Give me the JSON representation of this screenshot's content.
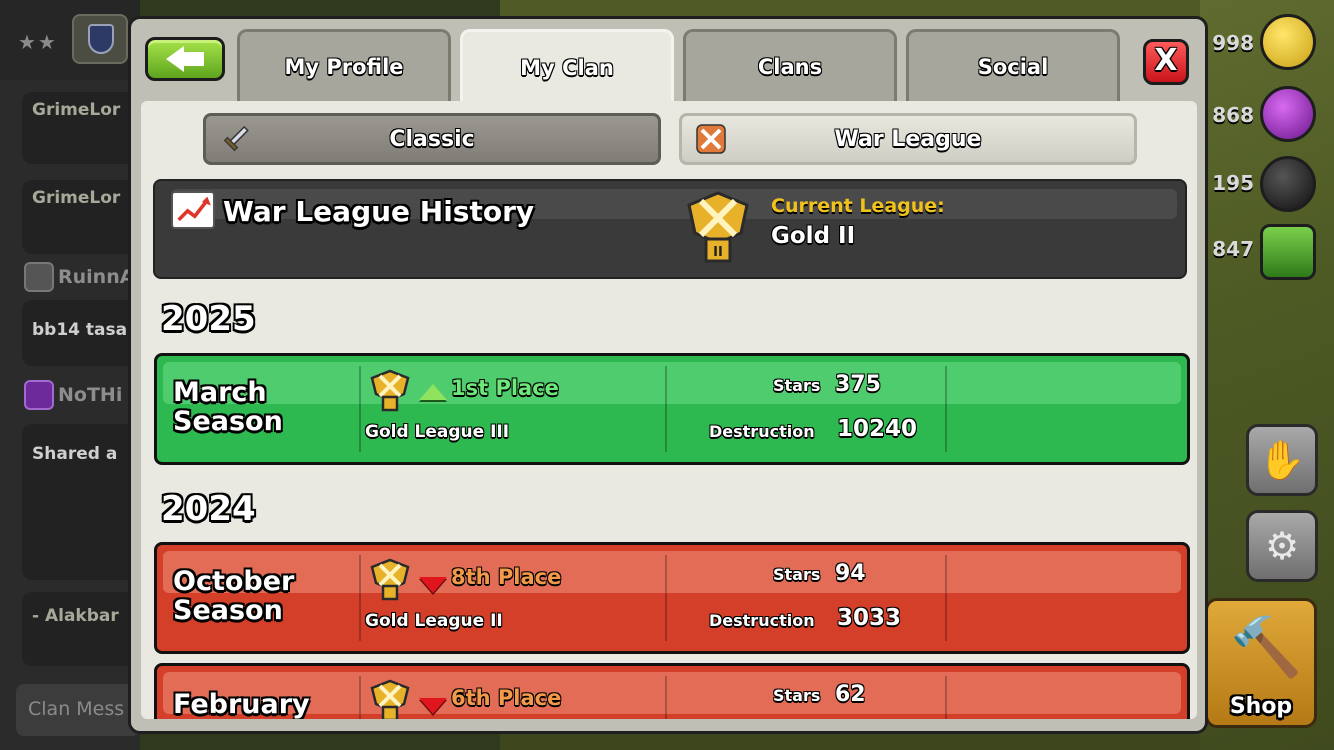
{
  "background": {
    "chat": {
      "messages": [
        {
          "user": "GrimeLor"
        },
        {
          "user": "GrimeLor"
        },
        {
          "user": "RuinnA",
          "text": "bb14 tasa"
        },
        {
          "user": "NoTHi",
          "text": "Shared a"
        },
        {
          "text": "- Alakbar"
        }
      ],
      "input_placeholder": "Clan Mess"
    },
    "resources": {
      "gold": "998",
      "elixir": "868",
      "dark_elixir": "195",
      "gems": "847"
    },
    "shop_label": "Shop"
  },
  "tabs": [
    {
      "label": "My Profile",
      "active": false
    },
    {
      "label": "My Clan",
      "active": true
    },
    {
      "label": "Clans",
      "active": false
    },
    {
      "label": "Social",
      "active": false
    }
  ],
  "close_label": "X",
  "sub_tabs": {
    "classic": "Classic",
    "war_league": "War League"
  },
  "history": {
    "title": "War League History",
    "current_league_label": "Current League:",
    "current_league_value": "Gold II",
    "badge_numeral": "II"
  },
  "years": [
    {
      "year": "2025",
      "seasons": [
        {
          "name": "March Season",
          "name_line1": "March",
          "name_line2": "Season",
          "result": "up",
          "place": "1st Place",
          "league": "Gold League III",
          "stars_label": "Stars",
          "stars": "375",
          "destruction_label": "Destruction",
          "destruction": "10240"
        }
      ]
    },
    {
      "year": "2024",
      "seasons": [
        {
          "name": "October Season",
          "name_line1": "October",
          "name_line2": "Season",
          "result": "down",
          "place": "8th Place",
          "league": "Gold League II",
          "stars_label": "Stars",
          "stars": "94",
          "destruction_label": "Destruction",
          "destruction": "3033"
        },
        {
          "name": "February",
          "name_line1": "February",
          "name_line2": "",
          "result": "down",
          "place": "6th Place",
          "league": "",
          "stars_label": "Stars",
          "stars": "62",
          "destruction_label": "",
          "destruction": ""
        }
      ]
    }
  ],
  "colors": {
    "season_up": "#2db94f",
    "season_down": "#d43f2a",
    "current_league_label": "#f2c21c"
  }
}
